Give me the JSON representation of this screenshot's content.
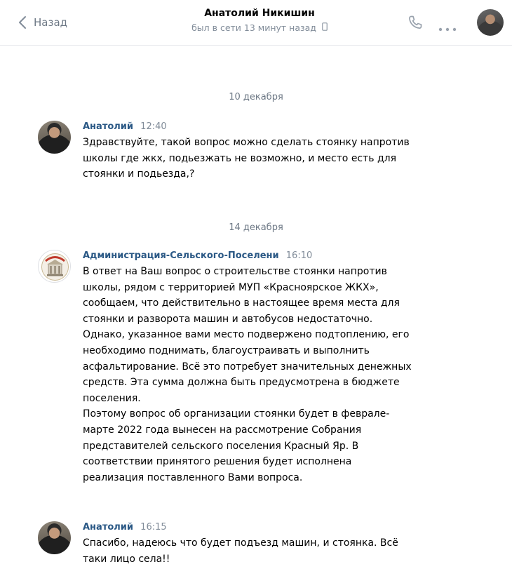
{
  "header": {
    "back_label": "Назад",
    "contact_name": "Анатолий Никишин",
    "status": "был в сети 13 минут назад",
    "icons": [
      "chevron-left-icon",
      "phone-icon",
      "more-icon",
      "mobile-device-icon"
    ]
  },
  "messages": [
    {
      "date": "10 декабря",
      "author": "Анатолий",
      "time": "12:40",
      "text": "Здравствуйте, такой вопрос можно сделать стоянку напротив\nшколы где жкх, подьезжать не возможно, и место есть для\nстоянки и подьезда,?"
    },
    {
      "date": "14 декабря",
      "author": "Администрация-Сельского-Поселени",
      "time": "16:10",
      "text": "В ответ на Ваш вопрос о строительстве стоянки напротив\nшколы, рядом с территорией МУП «Красноярское ЖКХ»,\nсообщаем, что действительно в настоящее время места для\nстоянки и разворота машин и автобусов недостаточно.\nОднако, указанное вами место подвержено подтоплению, его\nнеобходимо поднимать, благоустраивать и выполнить\nасфальтирование. Всё это потребует значительных денежных\nсредств. Эта сумма должна быть предусмотрена в бюджете\nпоселения.\nПоэтому вопрос об организации стоянки будет в феврале-\nмарте 2022 года вынесен на рассмотрение Собрания\nпредставителей сельского поселения Красный Яр. В\nсоответствии принятого решения будет исполнена\nреализация поставленного Вами вопроса."
    },
    {
      "author": "Анатолий",
      "time": "16:15",
      "text": "Спасибо, надеюсь что будет подъезд машин, и стоянка. Всё\nтаки лицо села!!"
    }
  ],
  "colors": {
    "author": "#2a5885",
    "secondary_text": "#818c99",
    "divider": "#e7e8ec"
  }
}
